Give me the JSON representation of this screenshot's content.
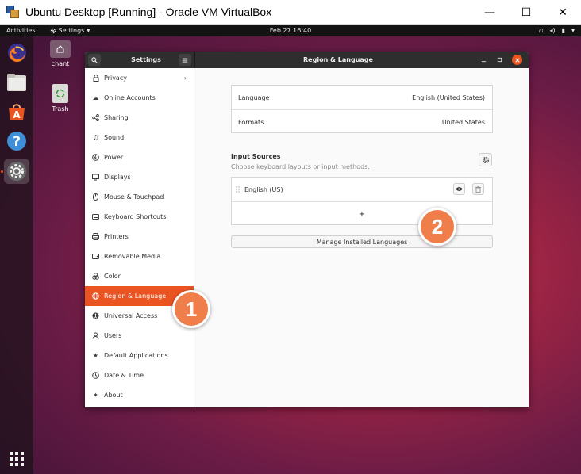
{
  "host_window": {
    "title": "Ubuntu Desktop [Running] - Oracle VM VirtualBox",
    "controls": {
      "minimize": "—",
      "maximize": "☐",
      "close": "✕"
    }
  },
  "topbar": {
    "activities": "Activities",
    "app_menu": "Settings",
    "app_menu_arrow": "▾",
    "clock": "Feb 27  16:40",
    "tray": {
      "network": "⛙",
      "volume": "◂)",
      "power": "▮",
      "menu_arrow": "▾"
    }
  },
  "dock": {
    "items": [
      {
        "name": "firefox-icon"
      },
      {
        "name": "files-icon"
      },
      {
        "name": "software-icon",
        "glyph": "A"
      },
      {
        "name": "help-icon",
        "glyph": "?"
      },
      {
        "name": "settings-icon",
        "active": true
      }
    ],
    "show_apps_icon": "show-apps-icon"
  },
  "desktop_icons": [
    {
      "label": "chant",
      "icon": "home-folder-icon"
    },
    {
      "label": "Trash",
      "icon": "trash-icon"
    }
  ],
  "settings": {
    "sidebar_title": "Settings",
    "panel_title": "Region & Language",
    "sidebar_items": [
      {
        "label": "Privacy",
        "icon": "🔒",
        "chevron": "›"
      },
      {
        "label": "Online Accounts",
        "icon": "☁"
      },
      {
        "label": "Sharing",
        "icon": "⟨"
      },
      {
        "label": "Sound",
        "icon": "♫"
      },
      {
        "label": "Power",
        "icon": "◌"
      },
      {
        "label": "Displays",
        "icon": "▭"
      },
      {
        "label": "Mouse & Touchpad",
        "icon": "◯"
      },
      {
        "label": "Keyboard Shortcuts",
        "icon": "⌨"
      },
      {
        "label": "Printers",
        "icon": "⎙"
      },
      {
        "label": "Removable Media",
        "icon": "▣"
      },
      {
        "label": "Color",
        "icon": "⁂"
      },
      {
        "label": "Region & Language",
        "icon": "⊕",
        "selected": true
      },
      {
        "label": "Universal Access",
        "icon": "✪"
      },
      {
        "label": "Users",
        "icon": "☺"
      },
      {
        "label": "Default Applications",
        "icon": "★"
      },
      {
        "label": "Date & Time",
        "icon": "◷"
      },
      {
        "label": "About",
        "icon": "✦"
      }
    ],
    "language": {
      "label": "Language",
      "value": "English (United States)"
    },
    "formats": {
      "label": "Formats",
      "value": "United States"
    },
    "input_sources": {
      "title": "Input Sources",
      "subtitle": "Choose keyboard layouts or input methods.",
      "items": [
        {
          "label": "English (US)"
        }
      ],
      "add_label": "+",
      "manage_button": "Manage Installed Languages"
    }
  },
  "callouts": [
    "1",
    "2"
  ],
  "colors": {
    "accent": "#e95420",
    "callout": "#f07e4a",
    "header": "#2e2e2e"
  }
}
